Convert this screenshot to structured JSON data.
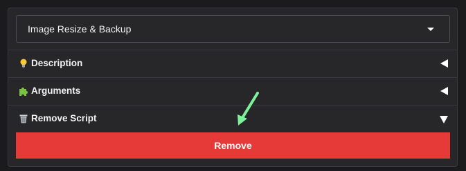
{
  "script_select": {
    "selected": "Image Resize & Backup",
    "caret_icon": "chevron-down-icon"
  },
  "sections": [
    {
      "label": "Description",
      "icon": "lightbulb-icon",
      "state": "collapsed"
    },
    {
      "label": "Arguments",
      "icon": "puzzle-piece-icon",
      "state": "collapsed"
    },
    {
      "label": "Remove Script",
      "icon": "trash-icon",
      "state": "expanded"
    }
  ],
  "remove_button": {
    "label": "Remove"
  },
  "colors": {
    "background": "#1b1b1d",
    "panel": "#27272a",
    "border": "#3a3a3e",
    "remove_button": "#e53a37",
    "annotation_arrow": "#7ef29a"
  }
}
